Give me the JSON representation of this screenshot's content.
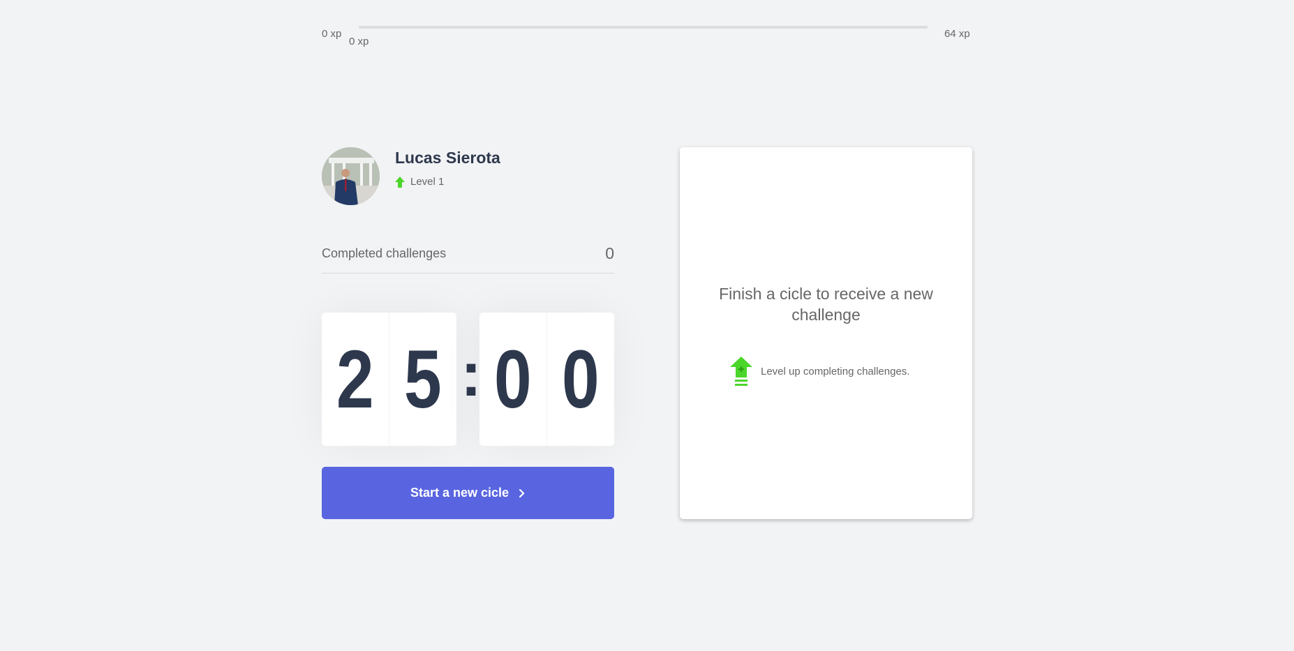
{
  "experience_bar": {
    "min_label": "0 xp",
    "current_label": "0 xp",
    "max_label": "64 xp",
    "progress_percent": 0
  },
  "profile": {
    "name": "Lucas Sierota",
    "level_label": "Level 1"
  },
  "completed_challenges": {
    "label": "Completed challenges",
    "count": "0"
  },
  "countdown": {
    "minute_left": "2",
    "minute_right": "5",
    "separator": ":",
    "second_left": "0",
    "second_right": "0"
  },
  "start_button": {
    "label": "Start a new cicle",
    "icon": "chevron-right-icon"
  },
  "challenge_box": {
    "title": "Finish a cicle to receive a new challenge",
    "hint": "Level up completing challenges.",
    "icon": "level-up-icon"
  },
  "colors": {
    "background": "#f2f3f5",
    "accent": "#5965e0",
    "green": "#4cd62b",
    "title": "#2e384d"
  }
}
